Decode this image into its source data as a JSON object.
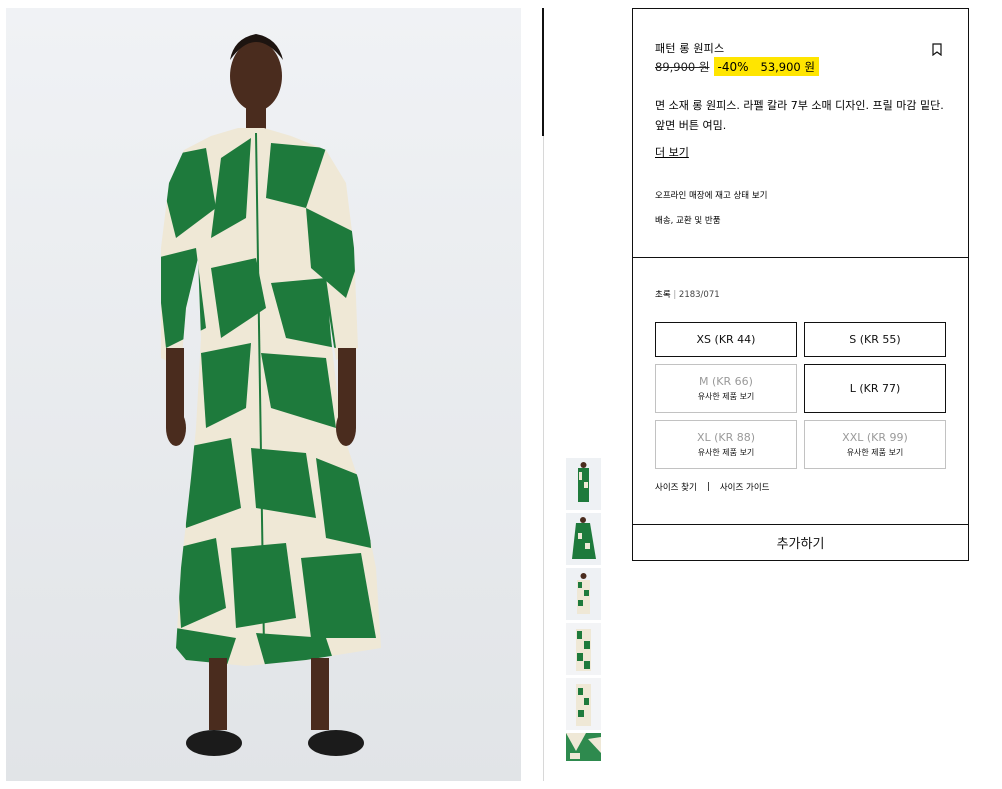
{
  "product": {
    "name": "패턴 롱 원피스",
    "old_price": "89,900 원",
    "discount": "-40%",
    "new_price": "53,900 원",
    "description": "면 소재 롱 원피스. 라펠 칼라 7부 소매 디자인. 프릴 마감 밑단. 앞면 버튼 여밈.",
    "more_label": "더 보기",
    "store_stock_label": "오프라인 매장에 재고 상태 보기",
    "shipping_label": "배송, 교환 및 반품"
  },
  "color": {
    "name": "초록",
    "separator": "|",
    "ref": "2183/071"
  },
  "sizes": [
    {
      "label": "XS (KR 44)",
      "sub": ""
    },
    {
      "label": "S (KR 55)",
      "sub": ""
    },
    {
      "label": "M (KR 66)",
      "sub": "유사한 제품 보기"
    },
    {
      "label": "L (KR 77)",
      "sub": ""
    },
    {
      "label": "XL (KR 88)",
      "sub": "유사한 제품 보기"
    },
    {
      "label": "XXL (KR 99)",
      "sub": "유사한 제품 보기"
    }
  ],
  "size_links": {
    "find_size": "사이즈 찾기",
    "divider": "|",
    "size_guide": "사이즈 가이드"
  },
  "add_button": "추가하기",
  "colors": {
    "sale_highlight": "#ffe500",
    "dress_green": "#1e7a3c",
    "dress_cream": "#efe8d6",
    "border": "#111111",
    "unavailable": "#9a9a9a"
  }
}
